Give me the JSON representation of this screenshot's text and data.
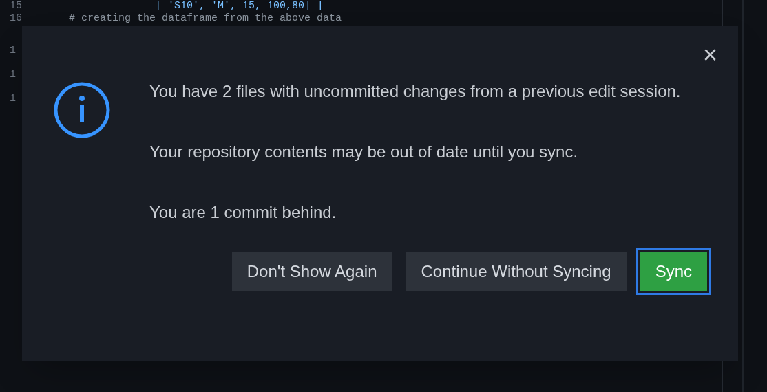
{
  "editor": {
    "lines": [
      {
        "number": "15",
        "code": "[ 'S10', 'M', 15, 100,80] ]"
      },
      {
        "number": "16",
        "code": "# creating the dataframe from the above data"
      },
      {
        "number": "1"
      },
      {
        "number": "1"
      },
      {
        "number": "1"
      }
    ]
  },
  "dialog": {
    "close": "×",
    "paragraphs": [
      "You have 2 files with uncommitted changes from a previous edit session.",
      "Your repository contents may be out of date until you sync.",
      "You are 1 commit behind."
    ],
    "buttons": [
      {
        "label": "Don't Show Again",
        "kind": "secondary"
      },
      {
        "label": "Continue Without Syncing",
        "kind": "secondary"
      },
      {
        "label": "Sync",
        "kind": "primary"
      }
    ]
  }
}
